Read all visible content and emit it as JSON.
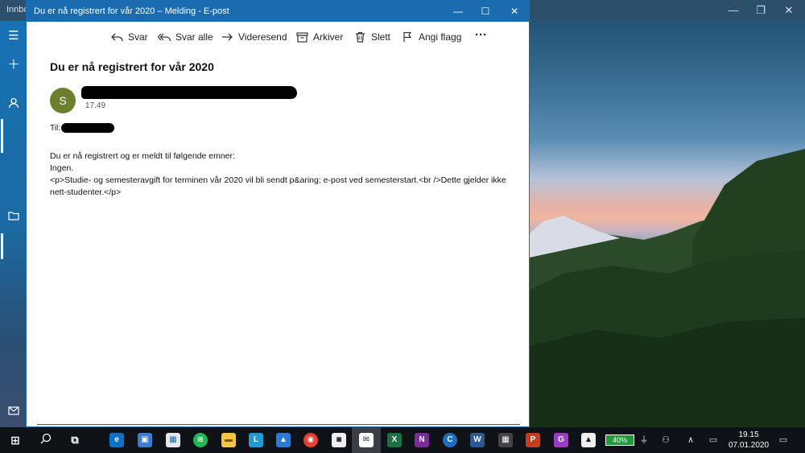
{
  "background_app": {
    "title": "Innbo"
  },
  "window": {
    "title": "Du er nå registrert for vår 2020 – Melding - E-post"
  },
  "toolbar": {
    "reply": "Svar",
    "reply_all": "Svar alle",
    "forward": "Videresend",
    "archive": "Arkiver",
    "delete": "Slett",
    "flag": "Angi flagg",
    "more": "···"
  },
  "message": {
    "subject": "Du er nå registrert for vår 2020",
    "avatar_initial": "S",
    "time": "17.49",
    "to_label": "Til:",
    "body_line1": "Du er nå registrert og er meldt til følgende emner:",
    "body_line2": "Ingen.",
    "body_line3": "<p>Studie- og semesteravgift for terminen vår 2020 vil bli sendt p&aring; e-post ved semesterstart.<br />Dette gjelder ikke nett-studenter.</p>"
  },
  "taskbar": {
    "battery": "40%",
    "clock_time": "19.15",
    "clock_date": "07.01.2020"
  },
  "colors": {
    "accent": "#1a6bb0",
    "avatar": "#6b7f2c",
    "taskbar": "#0f1318"
  }
}
